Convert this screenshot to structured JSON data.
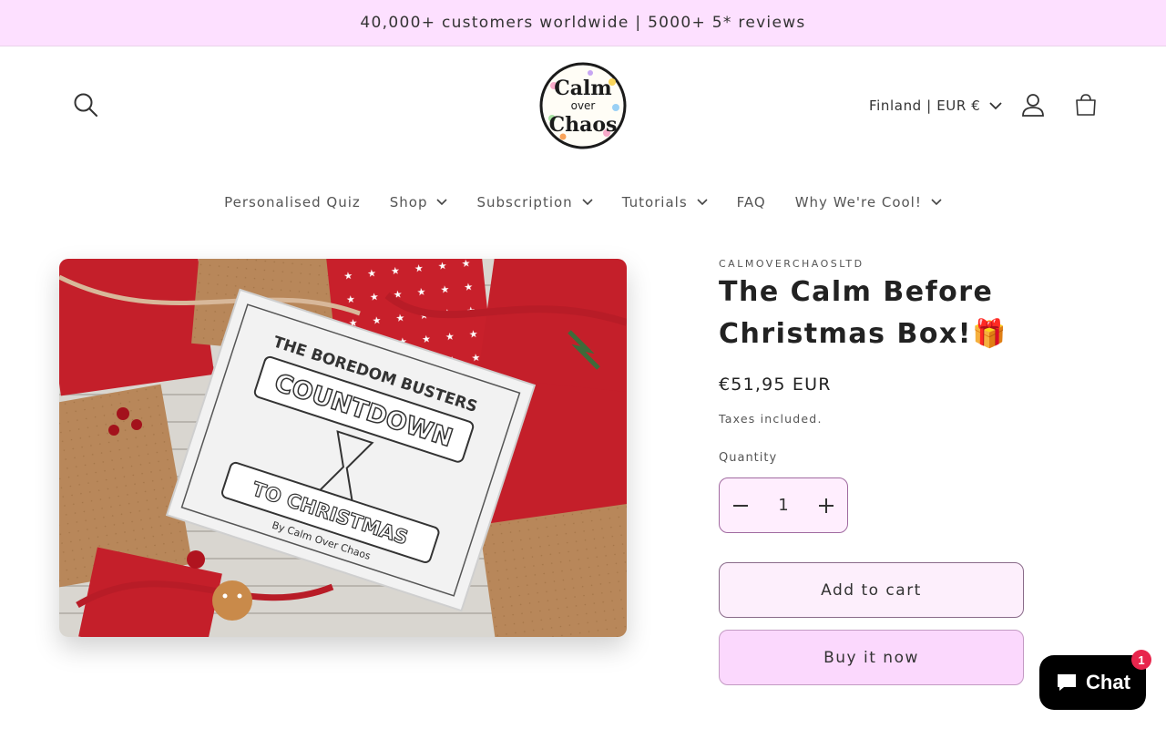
{
  "announcement": {
    "text": "40,000+ customers worldwide | 5000+ 5* reviews"
  },
  "header": {
    "logo_lines": [
      "Calm",
      "over",
      "Chaos"
    ],
    "country_selector": "Finland | EUR €"
  },
  "nav": {
    "items": [
      {
        "label": "Personalised Quiz",
        "has_dropdown": false
      },
      {
        "label": "Shop",
        "has_dropdown": true
      },
      {
        "label": "Subscription",
        "has_dropdown": true
      },
      {
        "label": "Tutorials",
        "has_dropdown": true
      },
      {
        "label": "FAQ",
        "has_dropdown": false
      },
      {
        "label": "Why We're Cool!",
        "has_dropdown": true
      }
    ]
  },
  "product": {
    "image": {
      "lines": [
        "THE BOREDOM BUSTERS",
        "COUNTDOWN",
        "TO CHRISTMAS",
        "By Calm Over Chaos"
      ]
    },
    "vendor": "CALMOVERCHAOSLTD",
    "title": "The Calm Before Christmas Box!🎁",
    "price": "€51,95 EUR",
    "tax_note": "Taxes included.",
    "quantity_label": "Quantity",
    "quantity_value": "1",
    "add_to_cart": "Add to cart",
    "buy_now": "Buy it now"
  },
  "chat": {
    "label": "Chat",
    "badge_count": "1"
  },
  "colors": {
    "announcement_bg": "#fde0ff",
    "add_to_cart_bg": "#fdeffc",
    "buy_now_bg": "#fbd8fd",
    "chat_bg": "#000000",
    "badge": "#e8264d"
  }
}
